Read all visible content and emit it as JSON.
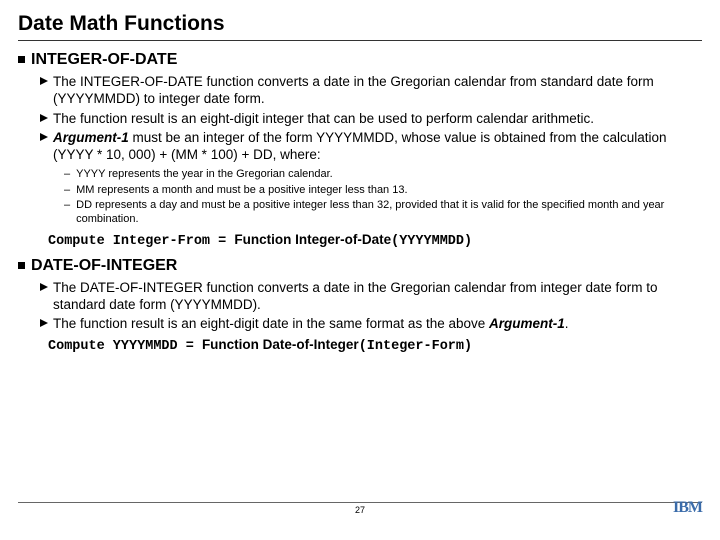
{
  "title": "Date Math Functions",
  "sections": [
    {
      "heading": "INTEGER-OF-DATE",
      "items": [
        {
          "text": "The INTEGER-OF-DATE function converts a date in the Gregorian calendar from standard date form (YYYYMMDD) to integer date form."
        },
        {
          "text": "The function result is an eight-digit integer that can be used to perform calendar arithmetic."
        },
        {
          "html": "<span class=\"bolditalic\">Argument-1</span> must be an integer of the form YYYYMMDD, whose value is obtained from the calculation (YYYY * 10, 000) + (MM * 100) + DD, where:"
        }
      ],
      "subitems": [
        "YYYY represents the year in the Gregorian calendar.",
        "MM represents a month and must be a positive integer less than 13.",
        "DD represents a day and must be a positive integer less than 32, provided that it is valid for the specified month and year combination."
      ],
      "code": {
        "mono1": "Compute Integer-From = ",
        "sans": "Function  Integer-of-Date",
        "mono2": "(YYYYMMDD)"
      }
    },
    {
      "heading": "DATE-OF-INTEGER",
      "items": [
        {
          "text": "The DATE-OF-INTEGER function converts a date in the Gregorian calendar from integer date form to standard date form (YYYYMMDD)."
        },
        {
          "html": "The function result is an eight-digit date in the same format as the above <span class=\"bolditalic\">Argument-1</span>."
        }
      ],
      "subitems": [],
      "code": {
        "mono1": "Compute YYYYMMDD = ",
        "sans": "Function  Date-of-Integer",
        "mono2": "(Integer-Form)"
      }
    }
  ],
  "footer": {
    "page": "27",
    "logo": "IBM"
  }
}
